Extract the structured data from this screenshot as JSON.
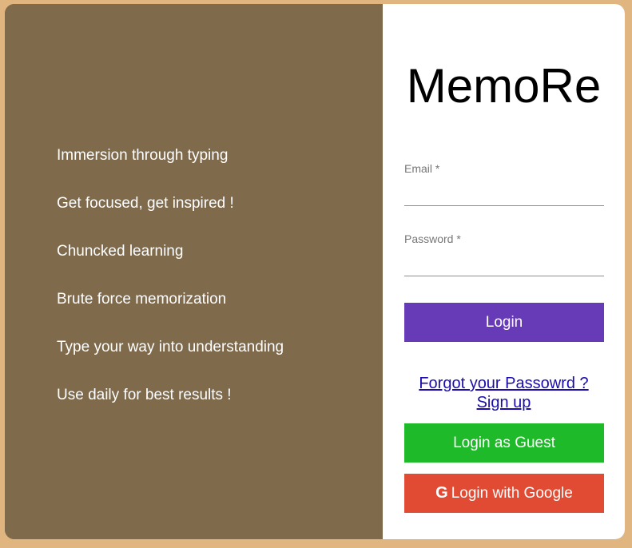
{
  "left_panel": {
    "features": [
      "Immersion through typing",
      "Get focused, get inspired !",
      "Chuncked learning",
      "Brute force memorization",
      "Type your way into understanding",
      "Use daily for best results !"
    ]
  },
  "right_panel": {
    "app_title": "MemoRe",
    "email": {
      "label": "Email *",
      "value": ""
    },
    "password": {
      "label": "Password *",
      "value": ""
    },
    "login_label": "Login",
    "forgot_password_label": "Forgot your Passowrd ?",
    "signup_label": "Sign up",
    "guest_label": "Login as Guest",
    "google_label": "Login with Google",
    "google_icon": "google-g-icon"
  },
  "colors": {
    "page_background": "#e0b57f",
    "left_panel": "#7f6a4c",
    "login_button": "#673ab7",
    "guest_button": "#1fba2a",
    "google_button": "#e24b33",
    "link": "#1a0dab"
  }
}
